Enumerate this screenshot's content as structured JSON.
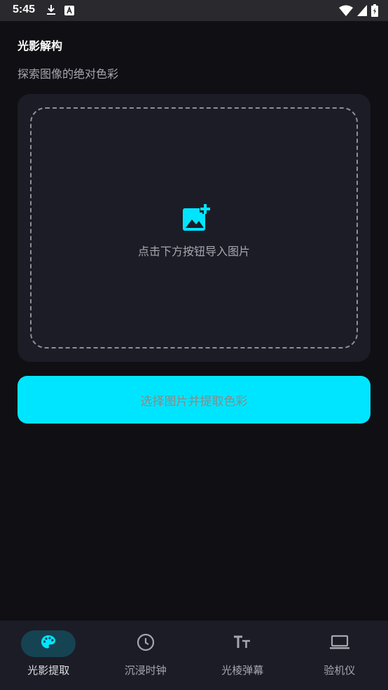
{
  "status_bar": {
    "time": "5:45",
    "left_icons": [
      "download-icon",
      "a-badge-icon"
    ],
    "right_icons": [
      "wifi-icon",
      "cell-signal-icon",
      "battery-icon"
    ]
  },
  "header": {
    "title": "光影解构",
    "subtitle": "探索图像的绝对色彩"
  },
  "upload_card": {
    "icon": "add-photo-icon",
    "hint": "点击下方按钮导入图片"
  },
  "primary_button": {
    "label": "选择图片并提取色彩"
  },
  "bottom_nav": {
    "items": [
      {
        "label": "光影提取",
        "icon": "palette-icon",
        "active": true
      },
      {
        "label": "沉浸时钟",
        "icon": "clock-icon",
        "active": false
      },
      {
        "label": "光棱弹幕",
        "icon": "text-size-icon",
        "active": false
      },
      {
        "label": "验机仪",
        "icon": "laptop-icon",
        "active": false
      }
    ]
  },
  "colors": {
    "background": "#0f0f14",
    "surface": "#1c1c26",
    "accent": "#00e5ff",
    "active_pill": "#154352",
    "muted_text": "#a6a6ae"
  }
}
